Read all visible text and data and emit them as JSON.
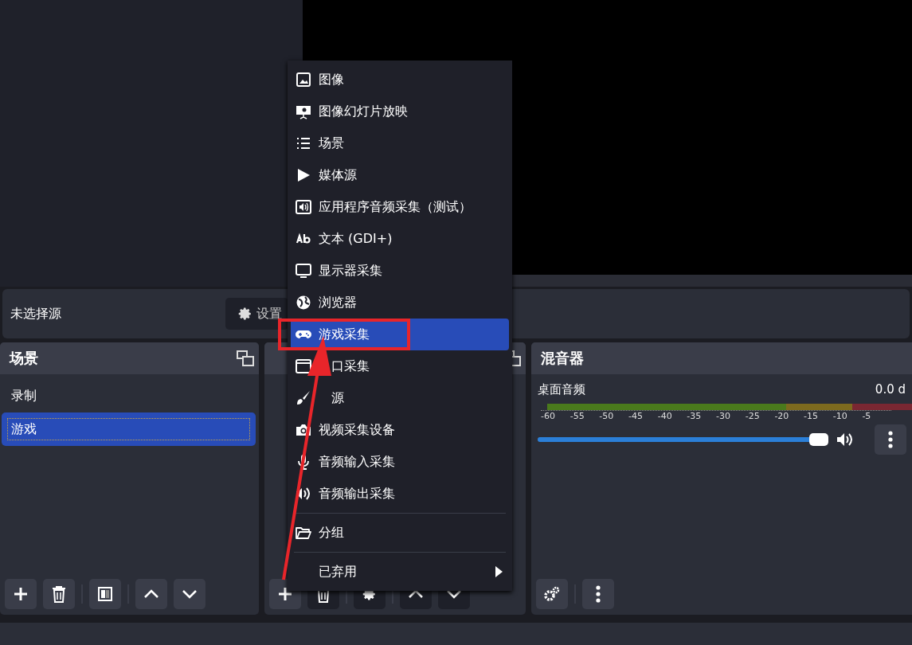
{
  "source_bar": {
    "label": "未选择源",
    "settings_button": "设置"
  },
  "scenes": {
    "title": "场景",
    "items": [
      {
        "label": "录制",
        "selected": false
      },
      {
        "label": "游戏",
        "selected": true
      }
    ]
  },
  "mixer": {
    "title": "混音器",
    "channels": [
      {
        "name": "桌面音频",
        "reading": "0.0 d",
        "level": 1,
        "ticks": [
          "-60",
          "-55",
          "-50",
          "-45",
          "-40",
          "-35",
          "-30",
          "-25",
          "-20",
          "-15",
          "-10",
          "-5"
        ]
      }
    ]
  },
  "context_menu": {
    "items": [
      {
        "kind": "item",
        "label": "图像",
        "selected": false
      },
      {
        "kind": "item",
        "label": "图像幻灯片放映",
        "selected": false
      },
      {
        "kind": "item",
        "label": "场景",
        "selected": false
      },
      {
        "kind": "item",
        "label": "媒体源",
        "selected": false
      },
      {
        "kind": "item",
        "label": "应用程序音频采集（测试）",
        "selected": false
      },
      {
        "kind": "item",
        "label": "文本 (GDI+)",
        "selected": false
      },
      {
        "kind": "item",
        "label": "显示器采集",
        "selected": false
      },
      {
        "kind": "item",
        "label": "浏览器",
        "selected": false
      },
      {
        "kind": "item",
        "label": "游戏采集",
        "selected": true
      },
      {
        "kind": "covered",
        "label": "口采集",
        "selected": false
      },
      {
        "kind": "covered",
        "label": "源",
        "selected": false
      },
      {
        "kind": "item",
        "label": "视频采集设备",
        "selected": false
      },
      {
        "kind": "item",
        "label": "音频输入采集",
        "selected": false
      },
      {
        "kind": "item",
        "label": "音频输出采集",
        "selected": false
      },
      {
        "kind": "separator"
      },
      {
        "kind": "item",
        "label": "分组",
        "selected": false
      },
      {
        "kind": "separator"
      },
      {
        "kind": "submenu",
        "label": "已弃用"
      }
    ]
  }
}
